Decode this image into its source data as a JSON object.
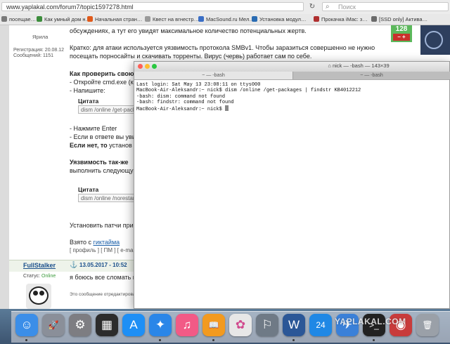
{
  "browser": {
    "url": "www.yaplakal.com/forum7/topic1597278.html",
    "search_placeholder": "Поиск",
    "bookmarks": [
      {
        "label": "посещае…",
        "color": "#7a7a7a"
      },
      {
        "label": "Как умный дом н…",
        "color": "#3c8d3c"
      },
      {
        "label": "Начальная стран…",
        "color": "#e05a1a"
      },
      {
        "label": "Квест на вгнестр…",
        "color": "#9a9a9a"
      },
      {
        "label": "MacSound.ru Мел…",
        "color": "#3a6ec6"
      },
      {
        "label": "Установка модул…",
        "color": "#2a6cb3"
      },
      {
        "label": "Прокачка iMac: з…",
        "color": "#b03030"
      },
      {
        "label": "[SSD only] Актива…",
        "color": "#6a6a6a"
      }
    ]
  },
  "post": {
    "author": "Ярила",
    "registration": "Регистрация: 20.08.12",
    "messages": "Сообщений: 1151",
    "rating": "128",
    "rating_controls": "– +",
    "lines": [
      "обсуждениях, а тут его увидят максимальное количество потенциальных жертв.",
      "Кратко: для атаки используется уязвимость протокола SMBv1. Чтобы заразиться совершенно не нужно",
      "посещать порносайты и скачивать торренты. Вирус (червь) работает сам по себе.",
      "Как проверить свою",
      "- Откройте cmd.exe (к",
      "- Напишите:",
      "- Нажмите Enter",
      "- Если в ответе вы уви",
      "Если нет, то",
      "установ",
      "Уязвимость так-же",
      "выполнить следующую",
      "Установить патчи при",
      "Взято с",
      "гиктайма"
    ],
    "quote1": {
      "label": "Цитата",
      "text": "dism /online /get-packa"
    },
    "quote2": {
      "label": "Цитата",
      "text": "dism /online /norestart"
    },
    "profile_links": "[ профиль ] [ ПМ ] [ e-ma"
  },
  "post2": {
    "author": "FullStalker",
    "date": "13.05.2017 - 10:52",
    "status_label": "Статус:",
    "status_value": "Online",
    "text": "я боюсь все сломать в",
    "edited": "Это сообщение отредактировал"
  },
  "terminal": {
    "title": "nick — -bash — 143×39",
    "tab1": "~ — -bash",
    "tab2": "~ — -bash",
    "lines": [
      "Last login: Sat May 13 23:08:11 on ttys000",
      "MacBook-Air-Aleksandr:~ nick$ dism /online /get-packages | findstr KB4012212",
      "-bash: dism: command not found",
      "-bash: findstr: command not found",
      "MacBook-Air-Aleksandr:~ nick$ "
    ],
    "colors": {
      "close": "#ff5f57",
      "minimize": "#febc2e",
      "zoom": "#28c840"
    }
  },
  "dock": {
    "watermark": "YAPLAKAL.COM",
    "apps": [
      {
        "name": "finder-icon",
        "glyph": "☺",
        "color": "#3b8ee8"
      },
      {
        "name": "launchpad-icon",
        "glyph": "🚀",
        "color": "#8a8f99"
      },
      {
        "name": "system-preferences-icon",
        "glyph": "⚙",
        "color": "#7d7d82"
      },
      {
        "name": "dashboard-icon",
        "glyph": "▦",
        "color": "#2c2c2c"
      },
      {
        "name": "app-store-icon",
        "glyph": "A",
        "color": "#1e8ff5"
      },
      {
        "name": "safari-icon",
        "glyph": "✦",
        "color": "#2a86e8"
      },
      {
        "name": "itunes-icon",
        "glyph": "♫",
        "color": "#f25a86"
      },
      {
        "name": "ibooks-icon",
        "glyph": "📖",
        "color": "#f29a1f"
      },
      {
        "name": "photos-icon",
        "glyph": "✿",
        "color": "#e7e7e7"
      },
      {
        "name": "network-utility-icon",
        "glyph": "⚐",
        "color": "#6f7a86"
      },
      {
        "name": "word-icon",
        "glyph": "W",
        "color": "#2b5797"
      },
      {
        "name": "calendar-24-icon",
        "glyph": "24",
        "color": "#1f88e5"
      },
      {
        "name": "spark-icon",
        "glyph": "✈",
        "color": "#3a80d8"
      },
      {
        "name": "terminal-icon",
        "glyph": ">_",
        "color": "#222222"
      },
      {
        "name": "photo-booth-icon",
        "glyph": "◉",
        "color": "#c83b3b"
      },
      {
        "name": "trash-icon",
        "glyph": "🗑",
        "color": "#9aa0a8"
      }
    ]
  }
}
